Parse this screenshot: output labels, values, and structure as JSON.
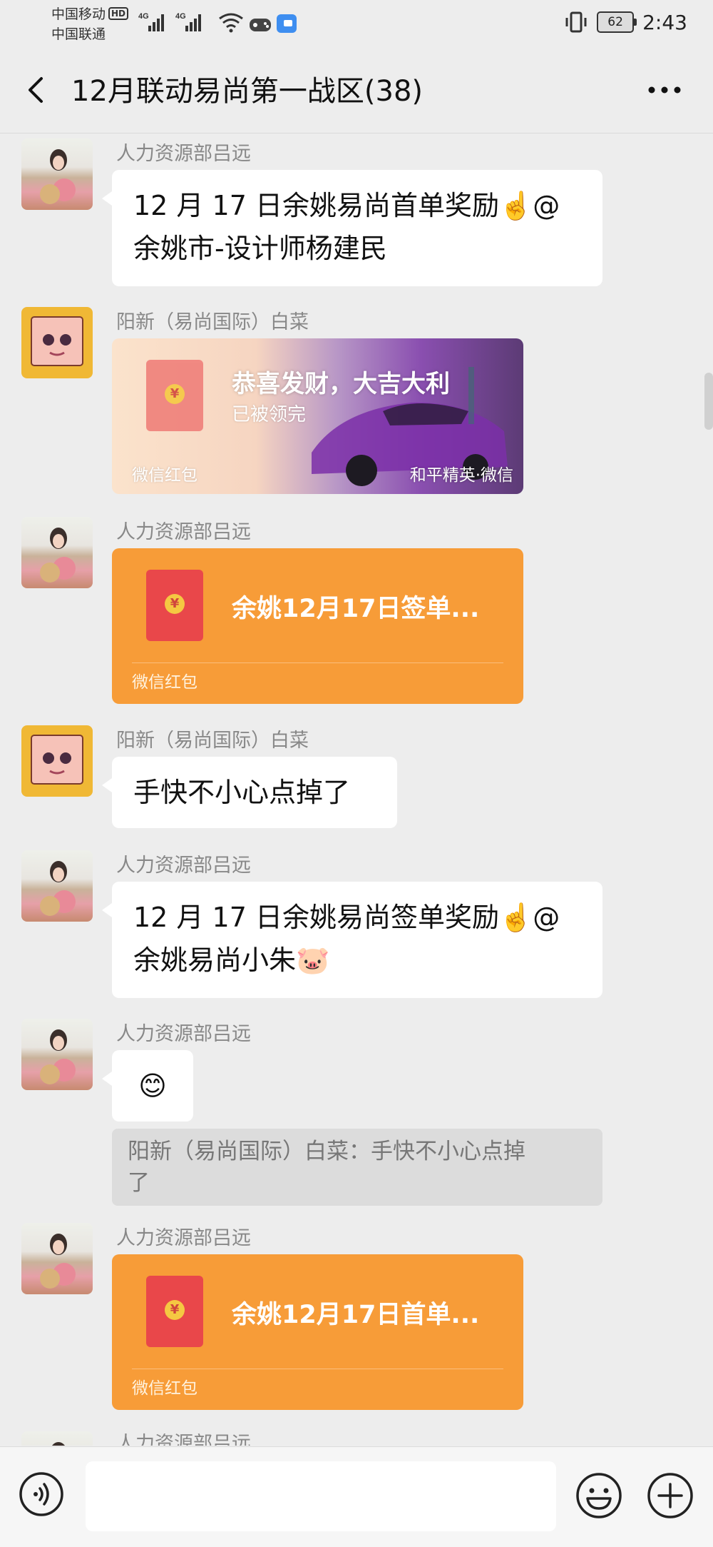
{
  "status_bar": {
    "carrier1": "中国移动",
    "hd": "HD",
    "carrier2": "中国联通",
    "net1": "4G",
    "net2": "4G",
    "battery": "62",
    "time": "2:43"
  },
  "header": {
    "title": "12月联动易尚第一战区(38)"
  },
  "messages": [
    {
      "sender": "人力资源部吕远",
      "text_line1": "12 月 17 日余姚易尚首单奖励☝️@",
      "text_line2": "余姚市-设计师杨建民"
    },
    {
      "sender": "阳新（易尚国际）白菜",
      "rp_title": "恭喜发财，大吉大利",
      "rp_status": "已被领完",
      "rp_footer": "微信红包",
      "rp_brand": "和平精英·微信"
    },
    {
      "sender": "人力资源部吕远",
      "rp_title": "余姚12月17日签单...",
      "rp_footer": "微信红包"
    },
    {
      "sender": "阳新（易尚国际）白菜",
      "text": "手快不小心点掉了"
    },
    {
      "sender": "人力资源部吕远",
      "text_line1": "12 月 17 日余姚易尚签单奖励☝️@",
      "text_line2": "余姚易尚小朱🐷"
    },
    {
      "sender": "人力资源部吕远",
      "text": "😊",
      "quote_line1": "阳新（易尚国际）白菜：手快不小心点掉",
      "quote_line2": "了"
    },
    {
      "sender": "人力资源部吕远",
      "rp_title": "余姚12月17日首单...",
      "rp_footer": "微信红包"
    },
    {
      "sender": "人力资源部吕远"
    }
  ],
  "input": {
    "value": ""
  },
  "icons": [
    "back-icon",
    "more-icon",
    "voice-icon",
    "emoji-icon",
    "plus-icon"
  ],
  "colors": {
    "background": "#ededed",
    "red_packet": "#f79c38",
    "bubble": "#ffffff"
  }
}
